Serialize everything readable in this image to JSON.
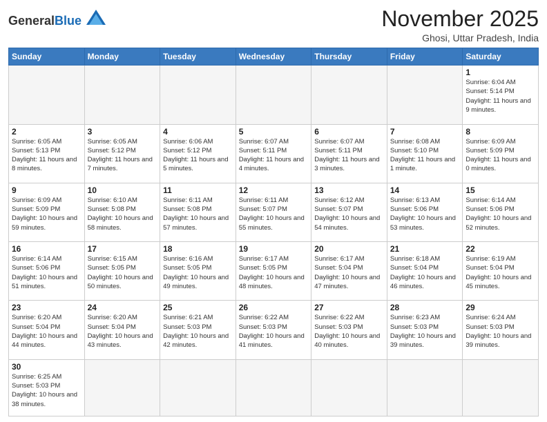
{
  "header": {
    "logo_general": "General",
    "logo_blue": "Blue",
    "title": "November 2025",
    "subtitle": "Ghosi, Uttar Pradesh, India"
  },
  "days_of_week": [
    "Sunday",
    "Monday",
    "Tuesday",
    "Wednesday",
    "Thursday",
    "Friday",
    "Saturday"
  ],
  "weeks": [
    [
      {
        "day": "",
        "empty": true
      },
      {
        "day": "",
        "empty": true
      },
      {
        "day": "",
        "empty": true
      },
      {
        "day": "",
        "empty": true
      },
      {
        "day": "",
        "empty": true
      },
      {
        "day": "",
        "empty": true
      },
      {
        "day": "1",
        "sunrise": "Sunrise: 6:04 AM",
        "sunset": "Sunset: 5:14 PM",
        "daylight": "Daylight: 11 hours and 9 minutes."
      }
    ],
    [
      {
        "day": "2",
        "sunrise": "Sunrise: 6:05 AM",
        "sunset": "Sunset: 5:13 PM",
        "daylight": "Daylight: 11 hours and 8 minutes."
      },
      {
        "day": "3",
        "sunrise": "Sunrise: 6:05 AM",
        "sunset": "Sunset: 5:12 PM",
        "daylight": "Daylight: 11 hours and 7 minutes."
      },
      {
        "day": "4",
        "sunrise": "Sunrise: 6:06 AM",
        "sunset": "Sunset: 5:12 PM",
        "daylight": "Daylight: 11 hours and 5 minutes."
      },
      {
        "day": "5",
        "sunrise": "Sunrise: 6:07 AM",
        "sunset": "Sunset: 5:11 PM",
        "daylight": "Daylight: 11 hours and 4 minutes."
      },
      {
        "day": "6",
        "sunrise": "Sunrise: 6:07 AM",
        "sunset": "Sunset: 5:11 PM",
        "daylight": "Daylight: 11 hours and 3 minutes."
      },
      {
        "day": "7",
        "sunrise": "Sunrise: 6:08 AM",
        "sunset": "Sunset: 5:10 PM",
        "daylight": "Daylight: 11 hours and 1 minute."
      },
      {
        "day": "8",
        "sunrise": "Sunrise: 6:09 AM",
        "sunset": "Sunset: 5:09 PM",
        "daylight": "Daylight: 11 hours and 0 minutes."
      }
    ],
    [
      {
        "day": "9",
        "sunrise": "Sunrise: 6:09 AM",
        "sunset": "Sunset: 5:09 PM",
        "daylight": "Daylight: 10 hours and 59 minutes."
      },
      {
        "day": "10",
        "sunrise": "Sunrise: 6:10 AM",
        "sunset": "Sunset: 5:08 PM",
        "daylight": "Daylight: 10 hours and 58 minutes."
      },
      {
        "day": "11",
        "sunrise": "Sunrise: 6:11 AM",
        "sunset": "Sunset: 5:08 PM",
        "daylight": "Daylight: 10 hours and 57 minutes."
      },
      {
        "day": "12",
        "sunrise": "Sunrise: 6:11 AM",
        "sunset": "Sunset: 5:07 PM",
        "daylight": "Daylight: 10 hours and 55 minutes."
      },
      {
        "day": "13",
        "sunrise": "Sunrise: 6:12 AM",
        "sunset": "Sunset: 5:07 PM",
        "daylight": "Daylight: 10 hours and 54 minutes."
      },
      {
        "day": "14",
        "sunrise": "Sunrise: 6:13 AM",
        "sunset": "Sunset: 5:06 PM",
        "daylight": "Daylight: 10 hours and 53 minutes."
      },
      {
        "day": "15",
        "sunrise": "Sunrise: 6:14 AM",
        "sunset": "Sunset: 5:06 PM",
        "daylight": "Daylight: 10 hours and 52 minutes."
      }
    ],
    [
      {
        "day": "16",
        "sunrise": "Sunrise: 6:14 AM",
        "sunset": "Sunset: 5:06 PM",
        "daylight": "Daylight: 10 hours and 51 minutes."
      },
      {
        "day": "17",
        "sunrise": "Sunrise: 6:15 AM",
        "sunset": "Sunset: 5:05 PM",
        "daylight": "Daylight: 10 hours and 50 minutes."
      },
      {
        "day": "18",
        "sunrise": "Sunrise: 6:16 AM",
        "sunset": "Sunset: 5:05 PM",
        "daylight": "Daylight: 10 hours and 49 minutes."
      },
      {
        "day": "19",
        "sunrise": "Sunrise: 6:17 AM",
        "sunset": "Sunset: 5:05 PM",
        "daylight": "Daylight: 10 hours and 48 minutes."
      },
      {
        "day": "20",
        "sunrise": "Sunrise: 6:17 AM",
        "sunset": "Sunset: 5:04 PM",
        "daylight": "Daylight: 10 hours and 47 minutes."
      },
      {
        "day": "21",
        "sunrise": "Sunrise: 6:18 AM",
        "sunset": "Sunset: 5:04 PM",
        "daylight": "Daylight: 10 hours and 46 minutes."
      },
      {
        "day": "22",
        "sunrise": "Sunrise: 6:19 AM",
        "sunset": "Sunset: 5:04 PM",
        "daylight": "Daylight: 10 hours and 45 minutes."
      }
    ],
    [
      {
        "day": "23",
        "sunrise": "Sunrise: 6:20 AM",
        "sunset": "Sunset: 5:04 PM",
        "daylight": "Daylight: 10 hours and 44 minutes."
      },
      {
        "day": "24",
        "sunrise": "Sunrise: 6:20 AM",
        "sunset": "Sunset: 5:04 PM",
        "daylight": "Daylight: 10 hours and 43 minutes."
      },
      {
        "day": "25",
        "sunrise": "Sunrise: 6:21 AM",
        "sunset": "Sunset: 5:03 PM",
        "daylight": "Daylight: 10 hours and 42 minutes."
      },
      {
        "day": "26",
        "sunrise": "Sunrise: 6:22 AM",
        "sunset": "Sunset: 5:03 PM",
        "daylight": "Daylight: 10 hours and 41 minutes."
      },
      {
        "day": "27",
        "sunrise": "Sunrise: 6:22 AM",
        "sunset": "Sunset: 5:03 PM",
        "daylight": "Daylight: 10 hours and 40 minutes."
      },
      {
        "day": "28",
        "sunrise": "Sunrise: 6:23 AM",
        "sunset": "Sunset: 5:03 PM",
        "daylight": "Daylight: 10 hours and 39 minutes."
      },
      {
        "day": "29",
        "sunrise": "Sunrise: 6:24 AM",
        "sunset": "Sunset: 5:03 PM",
        "daylight": "Daylight: 10 hours and 39 minutes."
      }
    ],
    [
      {
        "day": "30",
        "sunrise": "Sunrise: 6:25 AM",
        "sunset": "Sunset: 5:03 PM",
        "daylight": "Daylight: 10 hours and 38 minutes."
      },
      {
        "day": "",
        "empty": true
      },
      {
        "day": "",
        "empty": true
      },
      {
        "day": "",
        "empty": true
      },
      {
        "day": "",
        "empty": true
      },
      {
        "day": "",
        "empty": true
      },
      {
        "day": "",
        "empty": true
      }
    ]
  ]
}
